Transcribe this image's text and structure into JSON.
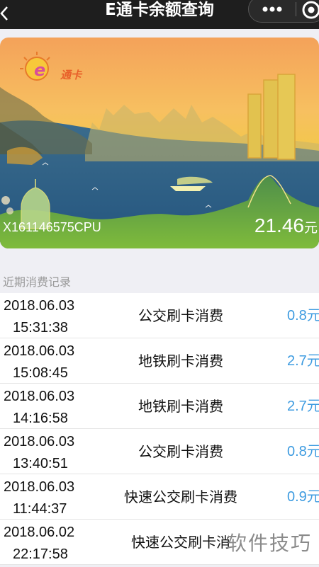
{
  "header": {
    "title": "E通卡余额查询",
    "icons": [
      "back-icon",
      "more-icon",
      "target-icon"
    ]
  },
  "card": {
    "brand": "通卡",
    "number": "X161146575CPU",
    "balance": "21.46",
    "balance_unit": "元",
    "colors": {
      "sky": "#f4a25a",
      "sea": "#2f5d8a",
      "land": "#6fa63a"
    }
  },
  "records": {
    "label": "近期消费记录",
    "rows": [
      {
        "date": "2018.06.03",
        "time": "15:31:38",
        "type": "公交刷卡消费",
        "amount": "0.8元"
      },
      {
        "date": "2018.06.03",
        "time": "15:08:45",
        "type": "地铁刷卡消费",
        "amount": "2.7元"
      },
      {
        "date": "2018.06.03",
        "time": "14:16:58",
        "type": "地铁刷卡消费",
        "amount": "2.7元"
      },
      {
        "date": "2018.06.03",
        "time": "13:40:51",
        "type": "公交刷卡消费",
        "amount": "0.8元"
      },
      {
        "date": "2018.06.03",
        "time": "11:44:37",
        "type": "快速公交刷卡消费",
        "amount": "0.9元"
      },
      {
        "date": "2018.06.02",
        "time": "22:17:58",
        "type": "快速公交刷卡消",
        "amount": ""
      }
    ],
    "accent": "#3d9be0"
  },
  "watermark": "软件技巧"
}
